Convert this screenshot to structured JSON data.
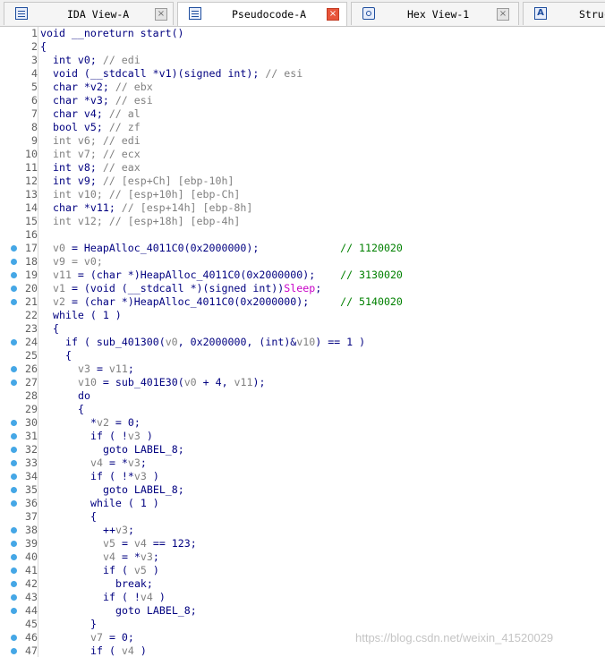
{
  "tabs": [
    {
      "label": "IDA View-A",
      "icon": "list-icon",
      "active": false
    },
    {
      "label": "Pseudocode-A",
      "icon": "list-icon",
      "active": true
    },
    {
      "label": "Hex View-1",
      "icon": "hex-icon",
      "active": false
    },
    {
      "label": "Struc",
      "icon": "struct-icon",
      "active": false
    }
  ],
  "struct_icon_glyph": "A",
  "close_glyph": "×",
  "lines": [
    {
      "n": "1",
      "bp": false,
      "indent": 0,
      "segs": [
        [
          "void __noreturn start()",
          "b"
        ]
      ]
    },
    {
      "n": "2",
      "bp": false,
      "indent": 0,
      "segs": [
        [
          "{",
          "b"
        ]
      ]
    },
    {
      "n": "3",
      "bp": false,
      "indent": 2,
      "segs": [
        [
          "int v0; ",
          "b"
        ],
        [
          "// edi",
          "g"
        ]
      ]
    },
    {
      "n": "4",
      "bp": false,
      "indent": 2,
      "segs": [
        [
          "void (__stdcall *v1)(signed int); ",
          "b"
        ],
        [
          "// esi",
          "g"
        ]
      ]
    },
    {
      "n": "5",
      "bp": false,
      "indent": 2,
      "segs": [
        [
          "char *v2; ",
          "b"
        ],
        [
          "// ebx",
          "g"
        ]
      ]
    },
    {
      "n": "6",
      "bp": false,
      "indent": 2,
      "segs": [
        [
          "char *v3; ",
          "b"
        ],
        [
          "// esi",
          "g"
        ]
      ]
    },
    {
      "n": "7",
      "bp": false,
      "indent": 2,
      "segs": [
        [
          "char v4; ",
          "b"
        ],
        [
          "// al",
          "g"
        ]
      ]
    },
    {
      "n": "8",
      "bp": false,
      "indent": 2,
      "segs": [
        [
          "bool v5; ",
          "b"
        ],
        [
          "// zf",
          "g"
        ]
      ]
    },
    {
      "n": "9",
      "bp": false,
      "indent": 2,
      "segs": [
        [
          "int v6; // edi",
          "g"
        ]
      ]
    },
    {
      "n": "10",
      "bp": false,
      "indent": 2,
      "segs": [
        [
          "int v7; // ecx",
          "g"
        ]
      ]
    },
    {
      "n": "11",
      "bp": false,
      "indent": 2,
      "segs": [
        [
          "int v8; ",
          "b"
        ],
        [
          "// eax",
          "g"
        ]
      ]
    },
    {
      "n": "12",
      "bp": false,
      "indent": 2,
      "segs": [
        [
          "int v9; ",
          "b"
        ],
        [
          "// [esp+Ch] [ebp-10h]",
          "g"
        ]
      ]
    },
    {
      "n": "13",
      "bp": false,
      "indent": 2,
      "segs": [
        [
          "int v10; // [esp+10h] [ebp-Ch]",
          "g"
        ]
      ]
    },
    {
      "n": "14",
      "bp": false,
      "indent": 2,
      "segs": [
        [
          "char *v11; ",
          "b"
        ],
        [
          "// [esp+14h] [ebp-8h]",
          "g"
        ]
      ]
    },
    {
      "n": "15",
      "bp": false,
      "indent": 2,
      "segs": [
        [
          "int v12; // [esp+18h] [ebp-4h]",
          "g"
        ]
      ]
    },
    {
      "n": "16",
      "bp": false,
      "indent": 0,
      "segs": []
    },
    {
      "n": "17",
      "bp": true,
      "indent": 2,
      "segs": [
        [
          "v0",
          "g"
        ],
        [
          " = HeapAlloc_4011C0(0x2000000);             ",
          "b"
        ],
        [
          "// 1120020",
          "k"
        ]
      ]
    },
    {
      "n": "18",
      "bp": true,
      "indent": 2,
      "segs": [
        [
          "v9 = v0;",
          "g"
        ]
      ]
    },
    {
      "n": "19",
      "bp": true,
      "indent": 2,
      "segs": [
        [
          "v11",
          "g"
        ],
        [
          " = (char *)HeapAlloc_4011C0(0x2000000);    ",
          "b"
        ],
        [
          "// 3130020",
          "k"
        ]
      ]
    },
    {
      "n": "20",
      "bp": true,
      "indent": 2,
      "segs": [
        [
          "v1",
          "g"
        ],
        [
          " = (void (__stdcall *)(signed int))",
          "b"
        ],
        [
          "Sleep",
          "p"
        ],
        [
          ";",
          "b"
        ]
      ]
    },
    {
      "n": "21",
      "bp": true,
      "indent": 2,
      "segs": [
        [
          "v2",
          "g"
        ],
        [
          " = (char *)HeapAlloc_4011C0(0x2000000);     ",
          "b"
        ],
        [
          "// 5140020",
          "k"
        ]
      ]
    },
    {
      "n": "22",
      "bp": false,
      "indent": 2,
      "segs": [
        [
          "while ( 1 )",
          "b"
        ]
      ]
    },
    {
      "n": "23",
      "bp": false,
      "indent": 2,
      "segs": [
        [
          "{",
          "b"
        ]
      ]
    },
    {
      "n": "24",
      "bp": true,
      "indent": 4,
      "segs": [
        [
          "if ( sub_401300(",
          "b"
        ],
        [
          "v0",
          "g"
        ],
        [
          ", 0x2000000, (int)&",
          "b"
        ],
        [
          "v10",
          "g"
        ],
        [
          ") == 1 )",
          "b"
        ]
      ]
    },
    {
      "n": "25",
      "bp": false,
      "indent": 4,
      "segs": [
        [
          "{",
          "b"
        ]
      ]
    },
    {
      "n": "26",
      "bp": true,
      "indent": 6,
      "segs": [
        [
          "v3",
          "g"
        ],
        [
          " = ",
          "b"
        ],
        [
          "v11",
          "g"
        ],
        [
          ";",
          "b"
        ]
      ]
    },
    {
      "n": "27",
      "bp": true,
      "indent": 6,
      "segs": [
        [
          "v10",
          "g"
        ],
        [
          " = sub_401E30(",
          "b"
        ],
        [
          "v0",
          "g"
        ],
        [
          " + 4, ",
          "b"
        ],
        [
          "v11",
          "g"
        ],
        [
          ");",
          "b"
        ]
      ]
    },
    {
      "n": "28",
      "bp": false,
      "indent": 6,
      "segs": [
        [
          "do",
          "b"
        ]
      ]
    },
    {
      "n": "29",
      "bp": false,
      "indent": 6,
      "segs": [
        [
          "{",
          "b"
        ]
      ]
    },
    {
      "n": "30",
      "bp": true,
      "indent": 8,
      "segs": [
        [
          "*",
          "b"
        ],
        [
          "v2",
          "g"
        ],
        [
          " = 0;",
          "b"
        ]
      ]
    },
    {
      "n": "31",
      "bp": true,
      "indent": 8,
      "segs": [
        [
          "if ( !",
          "b"
        ],
        [
          "v3",
          "g"
        ],
        [
          " )",
          "b"
        ]
      ]
    },
    {
      "n": "32",
      "bp": true,
      "indent": 10,
      "segs": [
        [
          "goto LABEL_8;",
          "b"
        ]
      ]
    },
    {
      "n": "33",
      "bp": true,
      "indent": 8,
      "segs": [
        [
          "v4",
          "g"
        ],
        [
          " = *",
          "b"
        ],
        [
          "v3",
          "g"
        ],
        [
          ";",
          "b"
        ]
      ]
    },
    {
      "n": "34",
      "bp": true,
      "indent": 8,
      "segs": [
        [
          "if ( !*",
          "b"
        ],
        [
          "v3",
          "g"
        ],
        [
          " )",
          "b"
        ]
      ]
    },
    {
      "n": "35",
      "bp": true,
      "indent": 10,
      "segs": [
        [
          "goto LABEL_8;",
          "b"
        ]
      ]
    },
    {
      "n": "36",
      "bp": true,
      "indent": 8,
      "segs": [
        [
          "while ( 1 )",
          "b"
        ]
      ]
    },
    {
      "n": "37",
      "bp": false,
      "indent": 8,
      "segs": [
        [
          "{",
          "b"
        ]
      ]
    },
    {
      "n": "38",
      "bp": true,
      "indent": 10,
      "segs": [
        [
          "++",
          "b"
        ],
        [
          "v3",
          "g"
        ],
        [
          ";",
          "b"
        ]
      ]
    },
    {
      "n": "39",
      "bp": true,
      "indent": 10,
      "segs": [
        [
          "v5",
          "g"
        ],
        [
          " = ",
          "b"
        ],
        [
          "v4",
          "g"
        ],
        [
          " == 123;",
          "b"
        ]
      ]
    },
    {
      "n": "40",
      "bp": true,
      "indent": 10,
      "segs": [
        [
          "v4",
          "g"
        ],
        [
          " = *",
          "b"
        ],
        [
          "v3",
          "g"
        ],
        [
          ";",
          "b"
        ]
      ]
    },
    {
      "n": "41",
      "bp": true,
      "indent": 10,
      "segs": [
        [
          "if ( ",
          "b"
        ],
        [
          "v5",
          "g"
        ],
        [
          " )",
          "b"
        ]
      ]
    },
    {
      "n": "42",
      "bp": true,
      "indent": 12,
      "segs": [
        [
          "break;",
          "b"
        ]
      ]
    },
    {
      "n": "43",
      "bp": true,
      "indent": 10,
      "segs": [
        [
          "if ( !",
          "b"
        ],
        [
          "v4",
          "g"
        ],
        [
          " )",
          "b"
        ]
      ]
    },
    {
      "n": "44",
      "bp": true,
      "indent": 12,
      "segs": [
        [
          "goto LABEL_8;",
          "b"
        ]
      ]
    },
    {
      "n": "45",
      "bp": false,
      "indent": 8,
      "segs": [
        [
          "}",
          "b"
        ]
      ]
    },
    {
      "n": "46",
      "bp": true,
      "indent": 8,
      "segs": [
        [
          "v7",
          "g"
        ],
        [
          " = 0;",
          "b"
        ]
      ]
    },
    {
      "n": "47",
      "bp": true,
      "indent": 8,
      "segs": [
        [
          "if ( ",
          "b"
        ],
        [
          "v4",
          "g"
        ],
        [
          " )",
          "b"
        ]
      ]
    }
  ],
  "watermark": "https://blog.csdn.net/weixin_41520029",
  "colors": {
    "keyword": "#000080",
    "variable": "#808080",
    "comment_addr": "#008000",
    "import": "#c800c8",
    "breakpoint": "#45a7e6",
    "active_close": "#e8553a"
  }
}
